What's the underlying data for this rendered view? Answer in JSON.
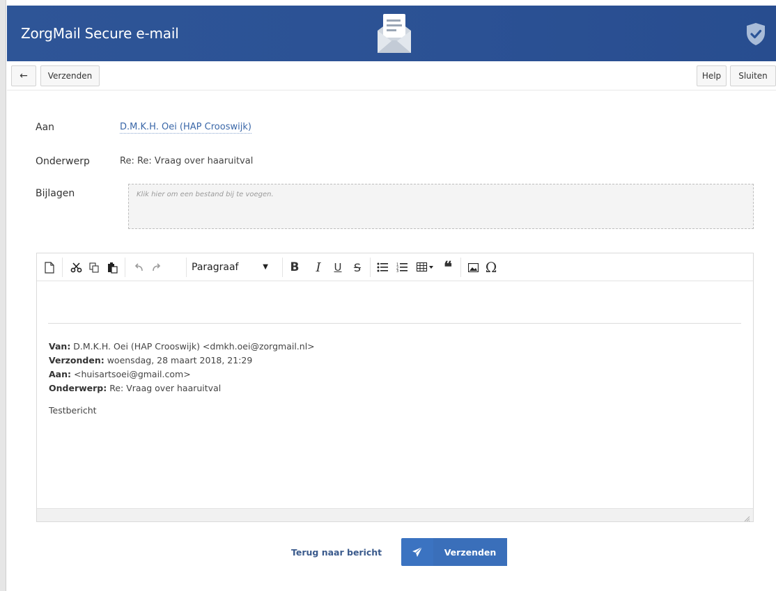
{
  "app": {
    "title": "ZorgMail Secure e-mail"
  },
  "toolbar": {
    "back_symbol": "←",
    "send_label": "Verzenden",
    "help_label": "Help",
    "close_label": "Sluiten"
  },
  "form": {
    "to_label": "Aan",
    "to_value": "D.M.K.H. Oei (HAP Crooswijk)",
    "subject_label": "Onderwerp",
    "subject_value": "Re: Re: Vraag over haaruitval",
    "attachments_label": "Bijlagen",
    "attachments_placeholder": "Klik hier om een bestand bij te voegen."
  },
  "editor": {
    "format_select": "Paragraaf",
    "quoted": {
      "from_label": "Van:",
      "from_value": " D.M.K.H. Oei (HAP Crooswijk) <dmkh.oei@zorgmail.nl>",
      "sent_label": "Verzonden:",
      "sent_value": " woensdag, 28 maart 2018, 21:29",
      "to_label": "Aan:",
      "to_value": " <huisartsoei@gmail.com>",
      "subject_label": "Onderwerp:",
      "subject_value": " Re: Vraag over haaruitval",
      "body": "Testbericht"
    }
  },
  "footer": {
    "back_link": "Terug naar bericht",
    "send_button": "Verzenden"
  },
  "colors": {
    "header": "#2c5598",
    "primary_button": "#3b73c1",
    "link": "#3a67a8"
  }
}
